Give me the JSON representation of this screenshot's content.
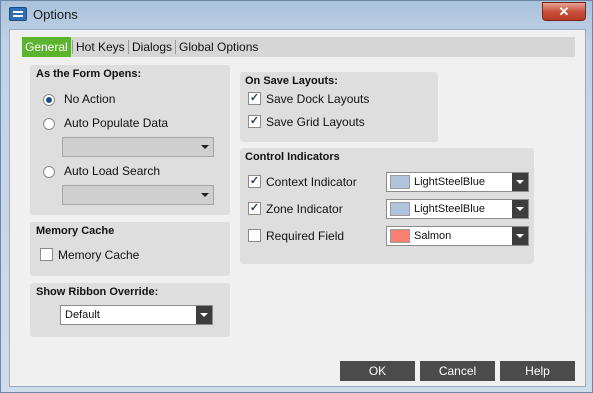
{
  "window": {
    "title": "Options",
    "close_label": "✕"
  },
  "tabs": [
    {
      "label": "General"
    },
    {
      "label": "Hot Keys"
    },
    {
      "label": "Dialogs"
    },
    {
      "label": "Global Options"
    }
  ],
  "form_opens": {
    "title": "As the Form Opens:",
    "options": [
      {
        "label": "No Action",
        "checked": true
      },
      {
        "label": "Auto Populate Data",
        "checked": false
      },
      {
        "label": "Auto Load Search",
        "checked": false
      }
    ]
  },
  "memory_cache": {
    "title": "Memory Cache",
    "checkbox_label": "Memory Cache",
    "checked": false
  },
  "ribbon_override": {
    "title": "Show Ribbon Override:",
    "selected": "Default"
  },
  "save_layouts": {
    "title": "On Save Layouts:",
    "items": [
      {
        "label": "Save Dock Layouts",
        "checked": true
      },
      {
        "label": "Save Grid Layouts",
        "checked": true
      }
    ]
  },
  "control_indicators": {
    "title": "Control Indicators",
    "items": [
      {
        "label": "Context Indicator",
        "checked": true,
        "color_name": "LightSteelBlue",
        "color": "#b0c4de"
      },
      {
        "label": "Zone Indicator",
        "checked": true,
        "color_name": "LightSteelBlue",
        "color": "#b0c4de"
      },
      {
        "label": "Required Field",
        "checked": false,
        "color_name": "Salmon",
        "color": "#fa8072"
      }
    ]
  },
  "buttons": {
    "ok": "OK",
    "cancel": "Cancel",
    "help": "Help"
  },
  "check_mark": "✓"
}
